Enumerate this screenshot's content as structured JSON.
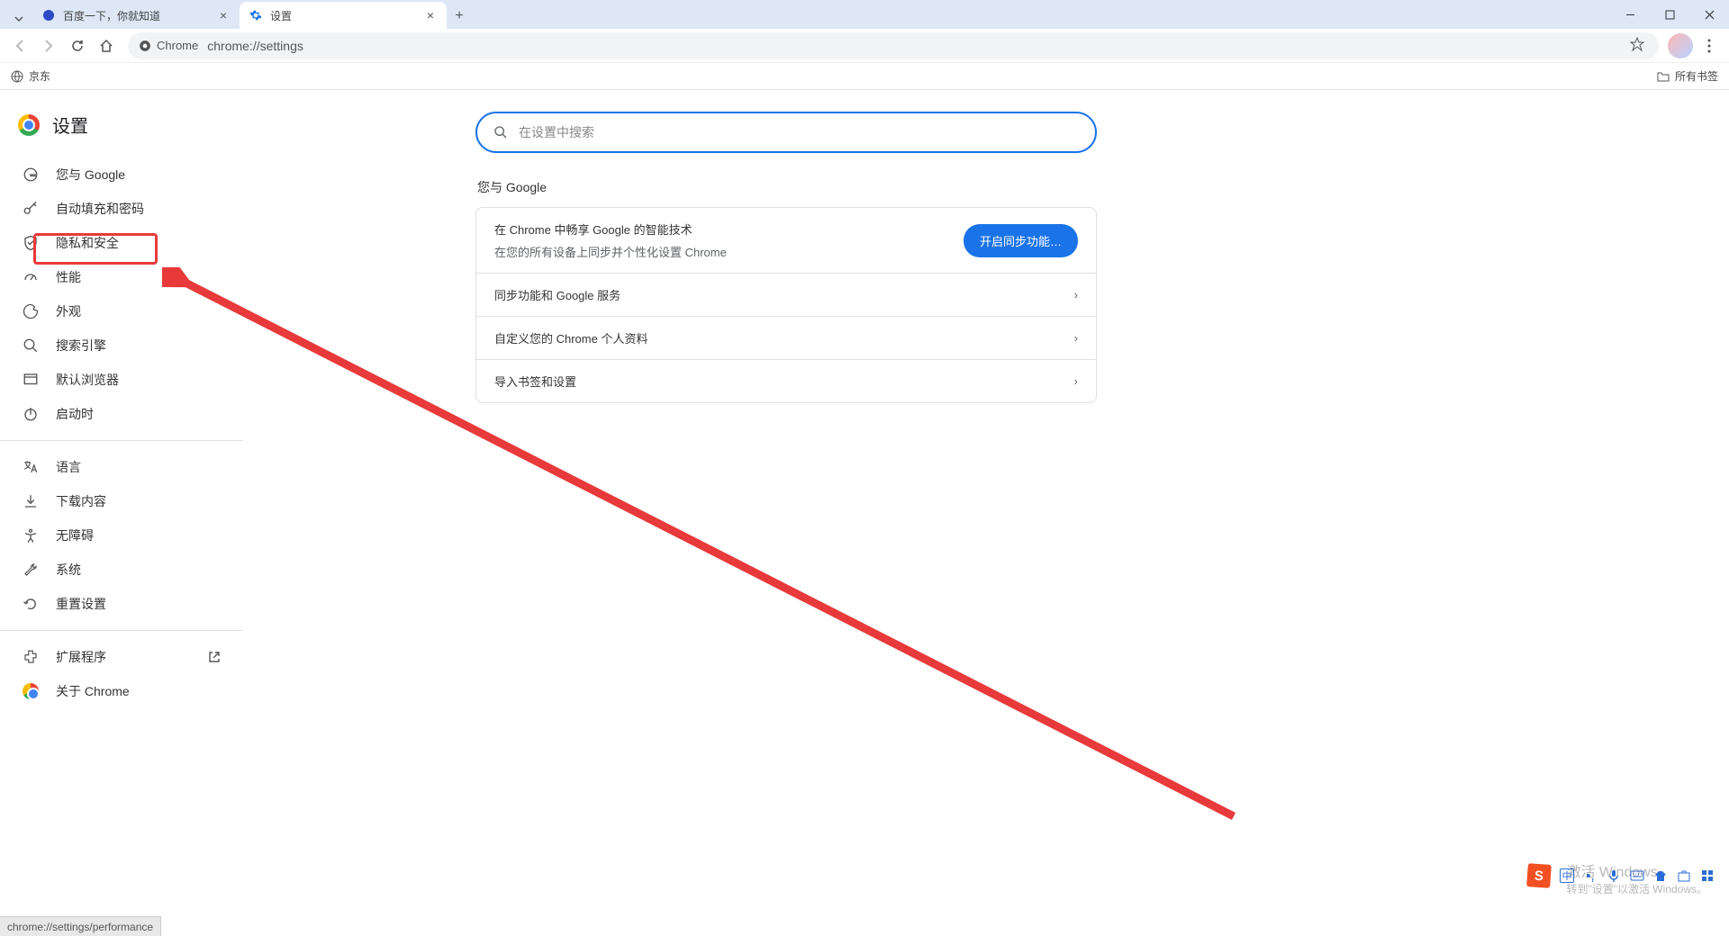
{
  "tabs": [
    {
      "title": "百度一下，你就知道"
    },
    {
      "title": "设置"
    }
  ],
  "titlebar": {
    "new_tab_tip": "+"
  },
  "toolbar": {
    "chrome_label": "Chrome",
    "url": "chrome://settings"
  },
  "bookmarks": {
    "jd": "京东",
    "all": "所有书签"
  },
  "sidebar": {
    "title": "设置",
    "items": [
      {
        "label": "您与 Google"
      },
      {
        "label": "自动填充和密码"
      },
      {
        "label": "隐私和安全"
      },
      {
        "label": "性能"
      },
      {
        "label": "外观"
      },
      {
        "label": "搜索引擎"
      },
      {
        "label": "默认浏览器"
      },
      {
        "label": "启动时"
      }
    ],
    "items2": [
      {
        "label": "语言"
      },
      {
        "label": "下载内容"
      },
      {
        "label": "无障碍"
      },
      {
        "label": "系统"
      },
      {
        "label": "重置设置"
      }
    ],
    "items3": [
      {
        "label": "扩展程序"
      },
      {
        "label": "关于 Chrome"
      }
    ]
  },
  "main": {
    "search_placeholder": "在设置中搜索",
    "section_label": "您与 Google",
    "sync": {
      "title": "在 Chrome 中畅享 Google 的智能技术",
      "sub": "在您的所有设备上同步并个性化设置 Chrome",
      "button": "开启同步功能…"
    },
    "rows": [
      "同步功能和 Google 服务",
      "自定义您的 Chrome 个人资料",
      "导入书签和设置"
    ]
  },
  "status_bar": "chrome://settings/performance",
  "watermark": {
    "line1": "激活 Windows",
    "line2": "转到\"设置\"以激活 Windows。"
  },
  "ime": {
    "zh": "中"
  }
}
